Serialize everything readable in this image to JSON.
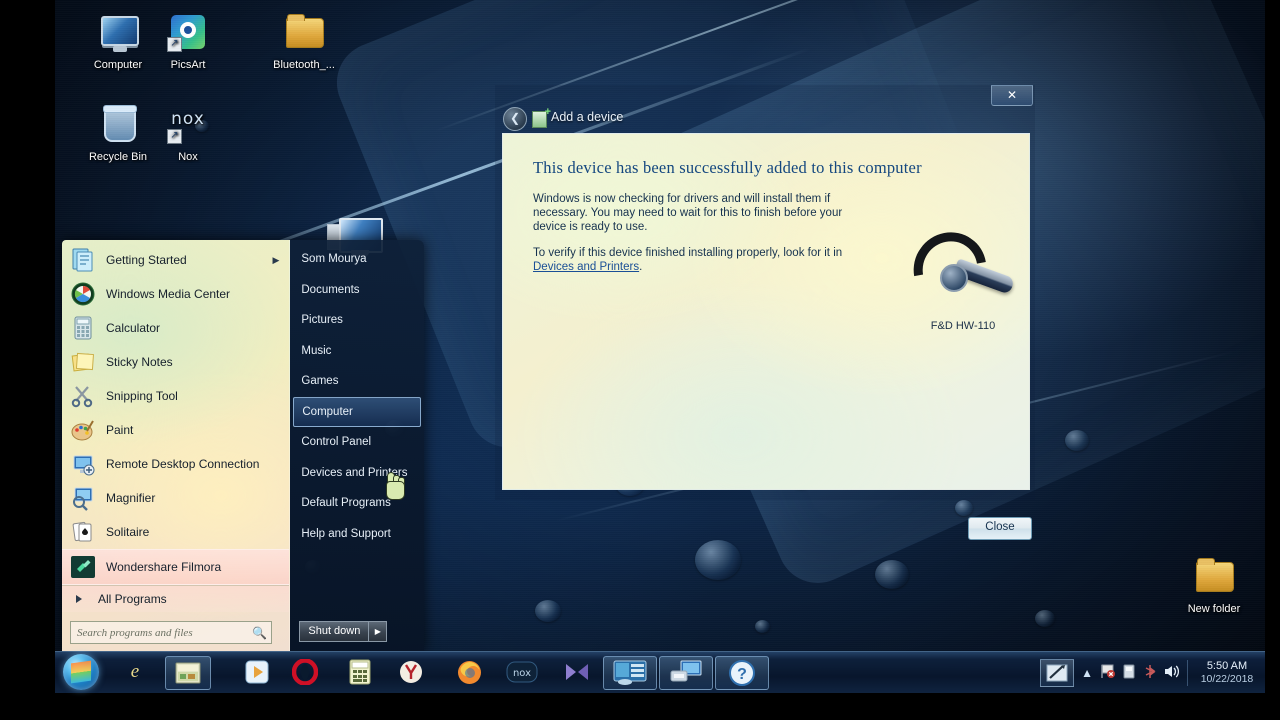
{
  "desktop": {
    "icons": [
      {
        "label": "Computer",
        "icon": "computer-icon"
      },
      {
        "label": "PicsArt",
        "icon": "picsart-icon"
      },
      {
        "label": "Bluetooth_...",
        "icon": "folder-icon"
      },
      {
        "label": "Recycle Bin",
        "icon": "recycle-bin-icon"
      },
      {
        "label": "Nox",
        "icon": "nox-icon"
      },
      {
        "label": "New folder",
        "icon": "folder-icon"
      }
    ]
  },
  "start_menu": {
    "left_items": [
      {
        "label": "Getting Started",
        "icon": "getting-started-icon",
        "has_submenu": true
      },
      {
        "label": "Windows Media Center",
        "icon": "media-center-icon",
        "has_submenu": false
      },
      {
        "label": "Calculator",
        "icon": "calculator-icon",
        "has_submenu": false
      },
      {
        "label": "Sticky Notes",
        "icon": "sticky-notes-icon",
        "has_submenu": false
      },
      {
        "label": "Snipping Tool",
        "icon": "snipping-tool-icon",
        "has_submenu": false
      },
      {
        "label": "Paint",
        "icon": "paint-icon",
        "has_submenu": false
      },
      {
        "label": "Remote Desktop Connection",
        "icon": "remote-desktop-icon",
        "has_submenu": false
      },
      {
        "label": "Magnifier",
        "icon": "magnifier-icon",
        "has_submenu": false
      },
      {
        "label": "Solitaire",
        "icon": "solitaire-icon",
        "has_submenu": false
      },
      {
        "label": "Wondershare Filmora",
        "icon": "filmora-icon",
        "has_submenu": false
      }
    ],
    "all_programs": "All Programs",
    "search_placeholder": "Search programs and files",
    "search_value": "",
    "right_items": [
      {
        "label": "Som Mourya",
        "selected": false
      },
      {
        "label": "Documents",
        "selected": false
      },
      {
        "label": "Pictures",
        "selected": false
      },
      {
        "label": "Music",
        "selected": false
      },
      {
        "label": "Games",
        "selected": false
      },
      {
        "label": "Computer",
        "selected": true
      },
      {
        "label": "Control Panel",
        "selected": false
      },
      {
        "label": "Devices and Printers",
        "selected": false
      },
      {
        "label": "Default Programs",
        "selected": false
      },
      {
        "label": "Help and Support",
        "selected": false
      }
    ],
    "shutdown": "Shut down"
  },
  "dialog": {
    "title": "Add a device",
    "close_x": "✕",
    "heading": "This device has been successfully added to this computer",
    "paragraph1": "Windows is now checking for drivers and will install them if necessary. You may need to wait for this to finish before your device is ready to use.",
    "paragraph2_before": "To verify if this device finished installing properly, look for it in ",
    "paragraph2_link": "Devices and Printers",
    "paragraph2_after": ".",
    "device_name": "F&D HW-110",
    "close_button": "Close"
  },
  "taskbar": {
    "start_label": "Start",
    "quick_launch": [
      {
        "name": "internet-explorer-icon",
        "glyph": "e"
      },
      {
        "name": "paint-taskbar-icon",
        "glyph": "▤"
      }
    ],
    "buttons": [
      {
        "name": "media-player-icon",
        "glyph": "▶",
        "active": false
      },
      {
        "name": "opera-icon",
        "glyph": "O",
        "active": false
      },
      {
        "name": "calculator-taskbar-icon",
        "glyph": "▦",
        "active": false
      },
      {
        "name": "yandex-icon",
        "glyph": "Y",
        "active": false
      },
      {
        "name": "firefox-icon",
        "glyph": "🦊",
        "active": false
      },
      {
        "name": "nox-taskbar-icon",
        "glyph": "nox",
        "active": false
      },
      {
        "name": "kmplayer-icon",
        "glyph": "◣◢",
        "active": false
      },
      {
        "name": "devices-and-printers-window",
        "glyph": "🖥",
        "active": true
      },
      {
        "name": "add-a-device-window",
        "glyph": "🖨",
        "active": true
      },
      {
        "name": "help-and-support-window",
        "glyph": "?",
        "active": true
      }
    ],
    "tray": {
      "icons": [
        {
          "name": "snipping-tool-tray-icon",
          "glyph": "✎"
        },
        {
          "name": "show-hidden-icons-chevron",
          "glyph": "▲"
        },
        {
          "name": "action-center-flag-icon",
          "glyph": "⚑"
        },
        {
          "name": "removable-media-icon",
          "glyph": "▯"
        },
        {
          "name": "bluetooth-tray-icon",
          "glyph": "✳"
        },
        {
          "name": "volume-icon",
          "glyph": "🔊"
        }
      ],
      "time": "5:50 AM",
      "date": "10/22/2018"
    }
  }
}
